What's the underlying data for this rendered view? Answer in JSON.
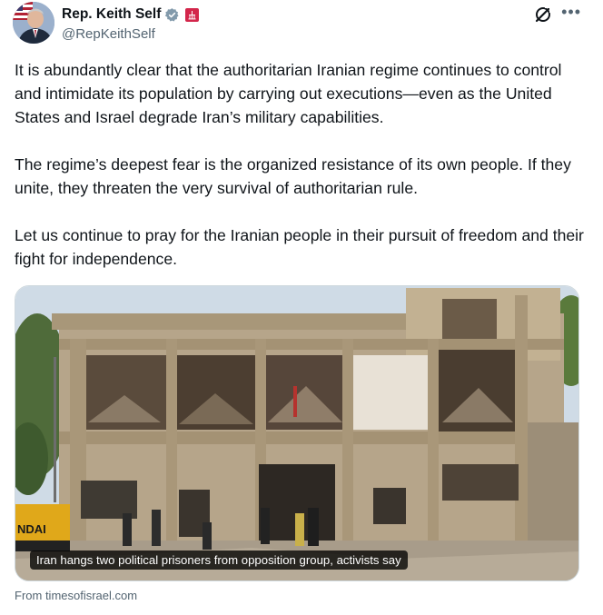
{
  "author": {
    "display_name": "Rep. Keith Self",
    "handle": "@RepKeithSelf",
    "verified_color": "#829aab",
    "gov_badge_color": "#d3264b"
  },
  "icons": {
    "verified": "verified-badge-icon",
    "government": "government-affiliation-icon",
    "grok": "grok-icon",
    "more": "more-options-icon"
  },
  "tweet": {
    "paragraphs": [
      "It is abundantly clear that the authoritarian Iranian regime continues to control and intimidate its population by carrying out executions—even as the United States and Israel degrade Iran’s military capabilities.",
      "The regime’s deepest fear is the organized resistance of its own people. If they unite, they threaten the very survival of authoritarian rule.",
      "Let us continue to pray for the Iranian people in their pursuit of freedom and their fight for independence."
    ]
  },
  "card": {
    "image_overlay_text": "NDAI",
    "headline": "Iran hangs two political prisoners from opposition group, activists say",
    "source": "From timesofisrael.com"
  }
}
